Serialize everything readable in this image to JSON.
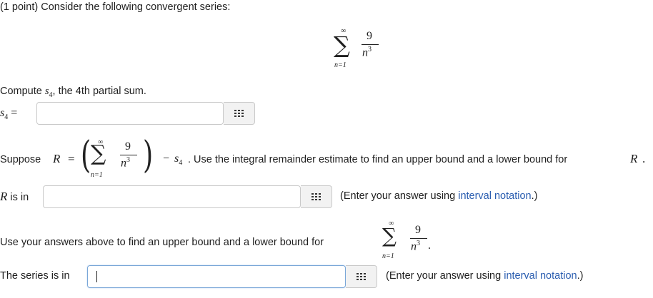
{
  "intro": "(1 point) Consider the following convergent series:",
  "series": {
    "sum_symbol": "∑",
    "upper": "∞",
    "lower": "n=1",
    "numerator": "9",
    "denominator_base": "n",
    "denominator_exp": "3"
  },
  "q1": {
    "prompt_pre": "Compute",
    "prompt_var": "s",
    "prompt_sub": "4",
    "prompt_post": ", the 4th partial sum.",
    "label_var": "s",
    "label_sub": "4",
    "label_eq": " ="
  },
  "q2": {
    "prompt_pre": "Suppose",
    "R": "R",
    "eq": "=",
    "minus": "−",
    "s": "s",
    "s_sub": "4",
    "post": ". Use the integral remainder estimate to find an upper bound and a lower bound for",
    "end_R": "R",
    "end_dot": ".",
    "answer_label_R": "R",
    "answer_label_post": " is in",
    "hint_pre": "(Enter your answer using ",
    "hint_link": "interval notation",
    "hint_post": ".)"
  },
  "q3": {
    "prompt": "Use your answers above to find an upper bound and a lower bound for",
    "end_dot": ".",
    "answer_label": "The series is in",
    "hint_pre": "(Enter your answer using ",
    "hint_link": "interval notation",
    "hint_post": ".)"
  },
  "icons": {
    "equation_editor": "grid-keyboard-icon"
  }
}
